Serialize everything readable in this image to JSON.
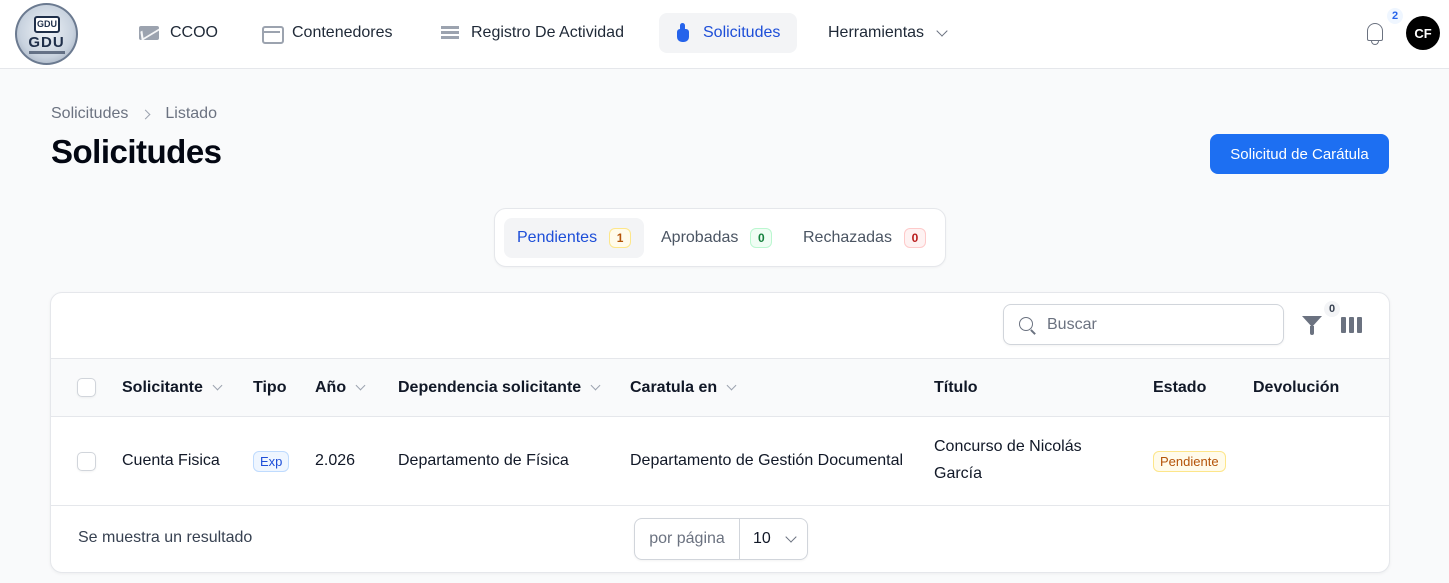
{
  "nav": {
    "logo_text": "GDU",
    "logo_badge": "GDU",
    "items": [
      {
        "label": "CCOO",
        "icon": "mail-icon"
      },
      {
        "label": "Contenedores",
        "icon": "box-icon"
      },
      {
        "label": "Registro De Actividad",
        "icon": "list-icon"
      },
      {
        "label": "Solicitudes",
        "icon": "hand-icon",
        "active": true
      },
      {
        "label": "Herramientas",
        "icon": "chevron-down-icon"
      }
    ],
    "notifications_count": "2",
    "avatar_initials": "CF"
  },
  "header": {
    "breadcrumb": [
      "Solicitudes",
      "Listado"
    ],
    "title": "Solicitudes",
    "primary_action": "Solicitud de Carátula"
  },
  "tabs": [
    {
      "label": "Pendientes",
      "count": "1",
      "active": true,
      "count_color": "#b45309",
      "count_bg": "#fffbeb",
      "count_border": "#fde68a"
    },
    {
      "label": "Aprobadas",
      "count": "0",
      "count_color": "#15803d",
      "count_bg": "#f0fdf4",
      "count_border": "#bbf7d0"
    },
    {
      "label": "Rechazadas",
      "count": "0",
      "count_color": "#b91c1c",
      "count_bg": "#fef2f2",
      "count_border": "#fecaca"
    }
  ],
  "table": {
    "search_placeholder": "Buscar",
    "filter_count": "0",
    "columns": [
      "Solicitante",
      "Tipo",
      "Año",
      "Dependencia solicitante",
      "Caratula en",
      "Título",
      "Estado",
      "Devolución"
    ],
    "rows": [
      {
        "solicitante": "Cuenta Fisica",
        "tipo": "Exp",
        "anio": "2.026",
        "dependencia": "Departamento de Física",
        "caratula_en": "Departamento de Gestión Documental",
        "titulo": "Concurso de Nicolás García",
        "estado": "Pendiente",
        "devolucion": ""
      }
    ],
    "footer_text": "Se muestra un resultado",
    "per_page_label": "por página",
    "per_page_value": "10"
  },
  "colors": {
    "accent": "#1d6ff2",
    "active_nav_text": "#1d4ed8",
    "status_pending_text": "#b45309",
    "status_pending_bg": "#fffbeb",
    "tipo_badge_text": "#1d4ed8",
    "tipo_badge_bg": "#eff6ff"
  }
}
